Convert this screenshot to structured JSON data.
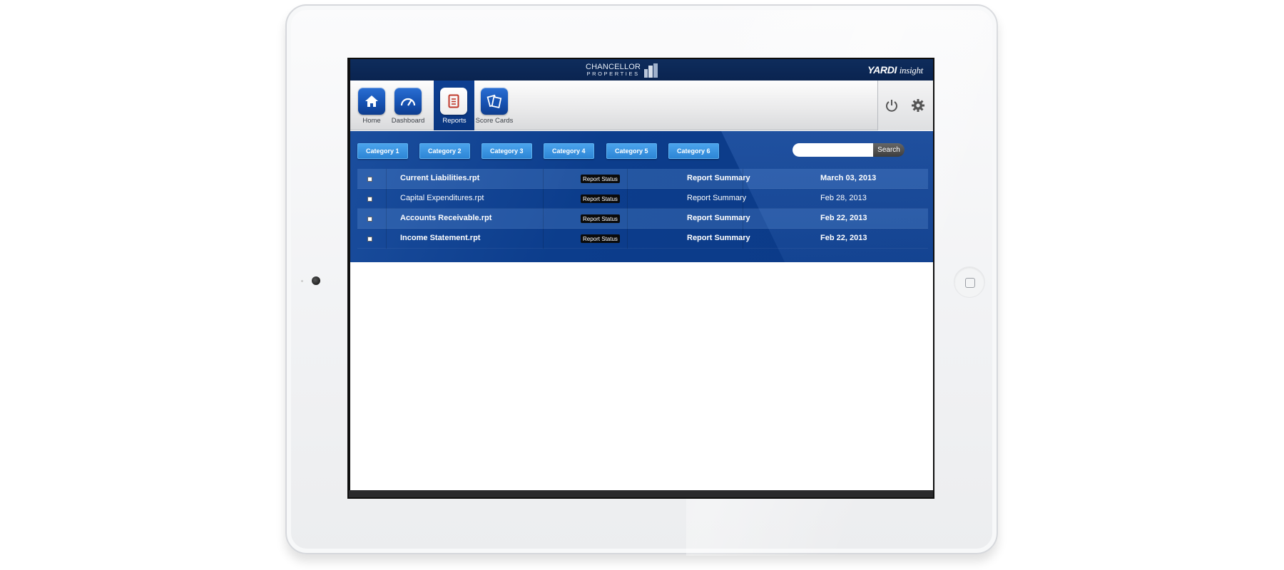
{
  "brand": {
    "company_line1": "CHANCELLOR",
    "company_line2": "PROPERTIES",
    "vendor_name": "YARDI",
    "vendor_product": "insight"
  },
  "nav": {
    "items": [
      {
        "label": "Home",
        "icon": "home-icon"
      },
      {
        "label": "Dashboard",
        "icon": "gauge-icon"
      },
      {
        "label": "Reports",
        "icon": "document-icon",
        "active": true
      },
      {
        "label": "Score Cards",
        "icon": "cards-icon"
      }
    ],
    "right_icons": [
      "power-icon",
      "gear-icon"
    ]
  },
  "categories": [
    "Category 1",
    "Category 2",
    "Category 3",
    "Category 4",
    "Category 5",
    "Category 6"
  ],
  "search": {
    "placeholder": "",
    "value": "",
    "button_label": "Search"
  },
  "reports": [
    {
      "name": "Current Liabilities.rpt",
      "status": "Report Status",
      "summary": "Report Summary",
      "date": "March 03, 2013",
      "bold": true
    },
    {
      "name": "Capital Expenditures.rpt",
      "status": "Report Status",
      "summary": "Report Summary",
      "date": "Feb 28, 2013",
      "bold": false
    },
    {
      "name": "Accounts Receivable.rpt",
      "status": "Report Status",
      "summary": "Report Summary",
      "date": "Feb 22, 2013",
      "bold": true
    },
    {
      "name": "Income Statement.rpt",
      "status": "Report Status",
      "summary": "Report Summary",
      "date": "Feb 22, 2013",
      "bold": true
    }
  ],
  "colors": {
    "brand_navy": "#0a2450",
    "content_blue": "#0c3d8c",
    "category_blue": "#2d86d6",
    "tile_blue": "#1652b3"
  }
}
